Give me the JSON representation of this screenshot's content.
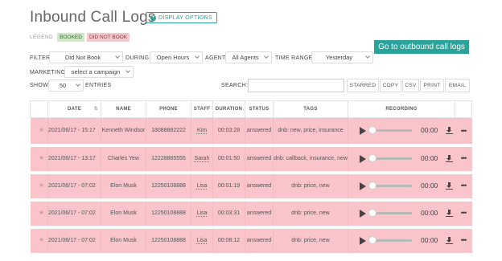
{
  "page": {
    "title": "Inbound Call Logs",
    "display_options": "DISPLAY OPTIONS",
    "outbound_button": "Go to outbound call logs"
  },
  "legend": {
    "label": "LEGEND",
    "booked": "BOOKED",
    "not_booked": "DID NOT BOOK"
  },
  "filters": {
    "filter_label": "FILTER:",
    "filter_value": "Did Not Book",
    "during_label": "DURING:",
    "during_value": "Open Hours",
    "agent_label": "AGENT:",
    "agent_value": "All Agents",
    "time_range_label": "TIME RANGE:",
    "time_range_value": "Yesterday",
    "marketing_label": "MARKETING:",
    "marketing_value": "select a campaign",
    "show_label": "SHOW",
    "show_value": "50",
    "entries_label": "ENTRIES",
    "search_label": "SEARCH:",
    "search_value": ""
  },
  "toolbar": {
    "starred": "STARRED",
    "copy": "COPY",
    "csv": "CSV",
    "print": "PRINT",
    "email": "EMAIL"
  },
  "table": {
    "headers": {
      "date": "DATE",
      "name": "NAME",
      "phone": "PHONE",
      "staff": "STAFF",
      "duration": "DURATION",
      "status": "STATUS",
      "tags": "TAGS",
      "recording": "RECORDING"
    },
    "rows": [
      {
        "date": "2021/06/17 - 15:17",
        "name": "Kenneth Windsor",
        "phone": "18088882222",
        "staff": "Kim",
        "duration": "00:03:28",
        "status": "answered",
        "tags": "dnb: new, price, insurance",
        "time": "00:00"
      },
      {
        "date": "2021/06/17 - 13:17",
        "name": "Charles Yew",
        "phone": "12228885555",
        "staff": "Sarah",
        "duration": "00:01:50",
        "status": "answered",
        "tags": "dnb: callback, insurance, new",
        "time": "00:00"
      },
      {
        "date": "2021/06/17 - 07:02",
        "name": "Elon Musk",
        "phone": "12250108888",
        "staff": "Lisa",
        "duration": "00:01:19",
        "status": "answered",
        "tags": "dnb: price, new",
        "time": "00:00"
      },
      {
        "date": "2021/06/17 - 07:02",
        "name": "Elon Musk",
        "phone": "12250108888",
        "staff": "Lisa",
        "duration": "00:03:31",
        "status": "answered",
        "tags": "dnb: price, new",
        "time": "00:00"
      },
      {
        "date": "2021/06/17 - 07:02",
        "name": "Elon Musk",
        "phone": "12250108888",
        "staff": "Lisa",
        "duration": "00:08:12",
        "status": "answered",
        "tags": "dnb: price, new",
        "time": "00:00"
      }
    ]
  },
  "icons": {
    "star": "star-icon",
    "play": "play-icon",
    "download": "download-icon",
    "more": "more-icon"
  },
  "colors": {
    "accent": "#2aa39a",
    "not_booked_row": "#f9c5cb",
    "booked_legend": "#cde9c6"
  }
}
